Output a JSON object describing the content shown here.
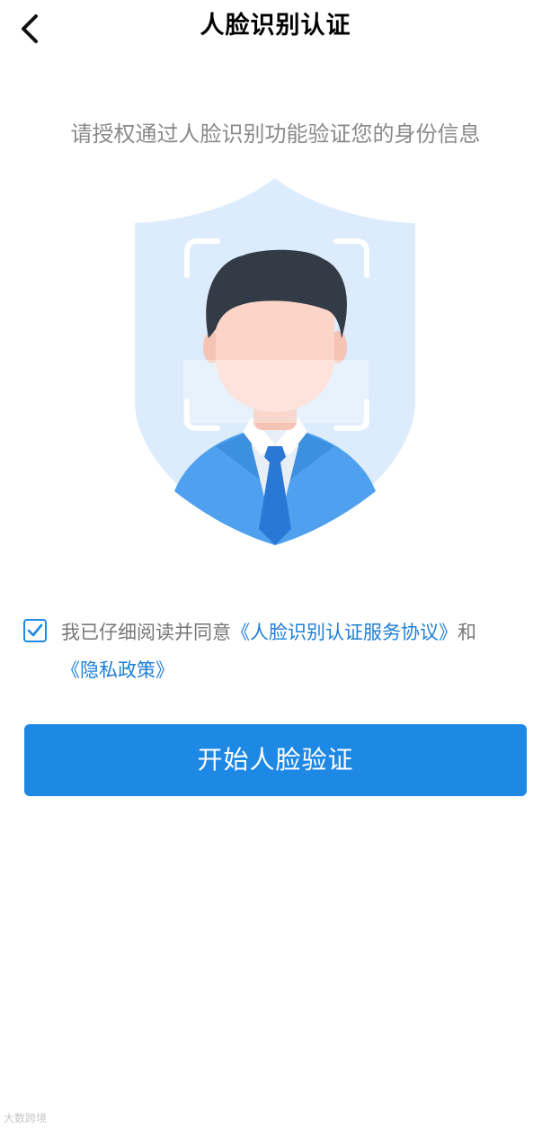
{
  "header": {
    "title": "人脸识别认证",
    "back_icon": "chevron-left-icon"
  },
  "subtitle": "请授权通过人脸识别功能验证您的身份信息",
  "illustration": {
    "name": "face-shield-illustration",
    "colors": {
      "shield": "#dcecfc",
      "hair": "#333b46",
      "skin": "#fcd5c8",
      "suit": "#4fa0ee",
      "tie": "#2a78d6",
      "frame": "#ffffff"
    }
  },
  "agreement": {
    "checked": true,
    "prefix": "我已仔细阅读并同意",
    "service_link": "《人脸识别认证服务协议》",
    "conjunction": "和",
    "privacy_link": "《隐私政策》"
  },
  "primary_button": {
    "label": "开始人脸验证"
  },
  "watermark": "大数跨境",
  "colors": {
    "accent": "#1e88e5",
    "link": "#1e7fd6",
    "muted_text": "#8a8a8a"
  }
}
